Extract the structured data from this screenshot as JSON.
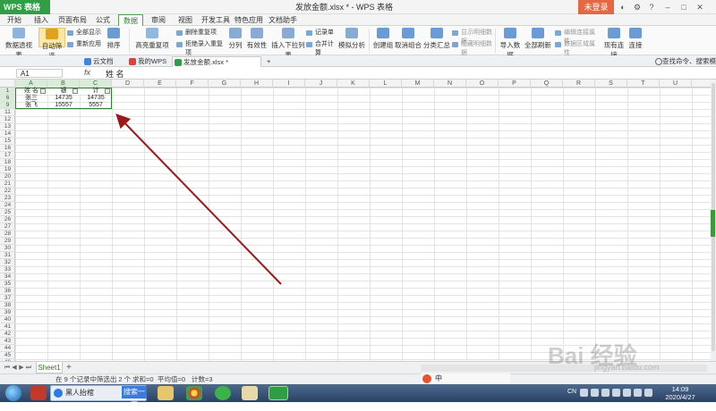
{
  "titlebar": {
    "app_button": "WPS 表格",
    "window_title": "发放金额.xlsx * - WPS 表格",
    "login_button": "未登录"
  },
  "menu": {
    "tabs": [
      "开始",
      "插入",
      "页面布局",
      "公式",
      "数据",
      "审阅",
      "视图",
      "开发工具",
      "特色应用",
      "文档助手"
    ],
    "active": "数据"
  },
  "ribbon": {
    "pivot": "数据透视表",
    "autofilter": "自动筛选",
    "show_all": "全部显示",
    "reapply": "重新应用",
    "sort": "排序",
    "highlight_dup": "高亮重复项",
    "remove_dup": "删除重复项",
    "reject_dup": "拒绝录入重复项",
    "split": "分列",
    "validation": "有效性",
    "dropdown": "插入下拉列表",
    "record": "记录单",
    "consolidate": "合并计算",
    "whatif": "模拟分析",
    "group": "创建组",
    "ungroup": "取消组合",
    "subtotal": "分类汇总",
    "show_detail": "显示明细数据",
    "hide_detail": "隐藏明细数据",
    "import": "导入数据",
    "refresh_all": "全部刷新",
    "edit_links": "编辑连接属性",
    "data_range": "数据区域属性",
    "existing_conn": "现有连接",
    "conn": "连接"
  },
  "doctabs": {
    "cloud": "云文档",
    "mywps": "我的WPS",
    "file": "发放金额.xlsx *",
    "search": "查找命令、搜索模板"
  },
  "formula": {
    "cell_ref": "A1",
    "fx": "fx",
    "value": "姓  名"
  },
  "grid": {
    "columns": [
      "A",
      "B",
      "C",
      "D",
      "E",
      "F",
      "G",
      "H",
      "I",
      "J",
      "K",
      "L",
      "M",
      "N",
      "O",
      "P",
      "Q",
      "R",
      "S",
      "T",
      "U"
    ],
    "rows": [
      "1",
      "6",
      "9",
      "11",
      "12",
      "13",
      "14",
      "15",
      "16",
      "17",
      "18",
      "19",
      "20",
      "21",
      "22",
      "23",
      "24",
      "25",
      "26",
      "27",
      "28",
      "29",
      "30",
      "31",
      "32",
      "33",
      "34",
      "35",
      "36",
      "37",
      "38",
      "39",
      "40",
      "41",
      "42",
      "43",
      "44",
      "45",
      "46",
      "47",
      "48"
    ],
    "header": [
      "姓  名",
      "银",
      "计"
    ],
    "data": [
      [
        "张三",
        "14735",
        "14735"
      ],
      [
        "张飞",
        "15557",
        "5557"
      ]
    ]
  },
  "sheets": {
    "tabs": [
      "Sheet1"
    ],
    "add": "+"
  },
  "status": {
    "text": "在 9 个记录中筛选出 2 个",
    "sum": "求和=0",
    "avg": "平均值=0",
    "count": "计数=3",
    "ime": "中"
  },
  "taskbar": {
    "ie_title": "黑人抬棺",
    "search_btn": "搜索一下",
    "time": "14:09",
    "date": "2020/4/27",
    "tray_label": "CN"
  },
  "watermark": {
    "text": "Bai 经验",
    "url": "jingyan.baidu.com"
  },
  "colors": {
    "wps_green": "#2f9e44",
    "login_orange": "#e56743",
    "arrow": "#9b1b1b",
    "selection": "#2e7d32"
  }
}
